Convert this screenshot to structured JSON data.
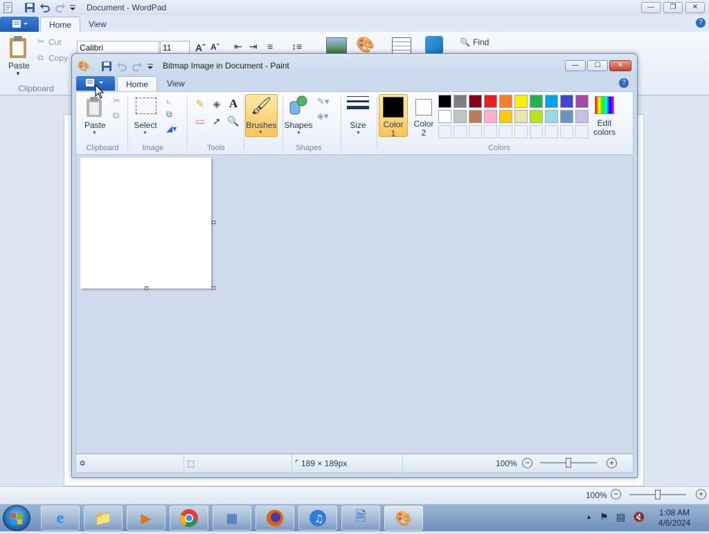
{
  "wordpad": {
    "title": "Document - WordPad",
    "tabs": [
      "Home",
      "View"
    ],
    "ribbon": {
      "paste_label": "Paste",
      "cut_label": "Cut",
      "copy_label": "Copy",
      "clipboard_group": "Clipboard",
      "font_name": "Calibri",
      "font_size": "11",
      "find_label": "Find"
    },
    "status": {
      "zoom": "100%"
    }
  },
  "paint": {
    "title": "Bitmap Image in Document - Paint",
    "tabs": [
      "Home",
      "View"
    ],
    "ribbon": {
      "paste_label": "Paste",
      "select_label": "Select",
      "brushes_label": "Brushes",
      "shapes_label": "Shapes",
      "size_label": "Size",
      "color1_line1": "Color",
      "color1_line2": "1",
      "color2_line1": "Color",
      "color2_line2": "2",
      "edit_colors_line1": "Edit",
      "edit_colors_line2": "colors",
      "groups": {
        "clipboard": "Clipboard",
        "image": "Image",
        "tools": "Tools",
        "shapes": "Shapes",
        "colors": "Colors"
      }
    },
    "palette_row1": [
      "#000000",
      "#7f7f7f",
      "#880015",
      "#ed1c24",
      "#ff7f27",
      "#fff200",
      "#22b14c",
      "#00a2e8",
      "#3f48cc",
      "#a349a4"
    ],
    "palette_row2": [
      "#ffffff",
      "#c3c3c3",
      "#b97a57",
      "#ffaec9",
      "#ffc90e",
      "#efe4b0",
      "#b5e61d",
      "#99d9ea",
      "#7092be",
      "#c8bfe7"
    ],
    "color1": "#000000",
    "color2": "#ffffff",
    "status": {
      "canvas_size": "189 × 189px",
      "zoom": "100%"
    }
  },
  "taskbar": {
    "apps": [
      "Internet Explorer",
      "Windows Explorer",
      "Windows Media Player",
      "Google Chrome",
      "Control Panel",
      "Firefox",
      "iTunes",
      "WordPad",
      "Paint"
    ],
    "time": "1:08 AM",
    "date": "4/6/2024"
  }
}
